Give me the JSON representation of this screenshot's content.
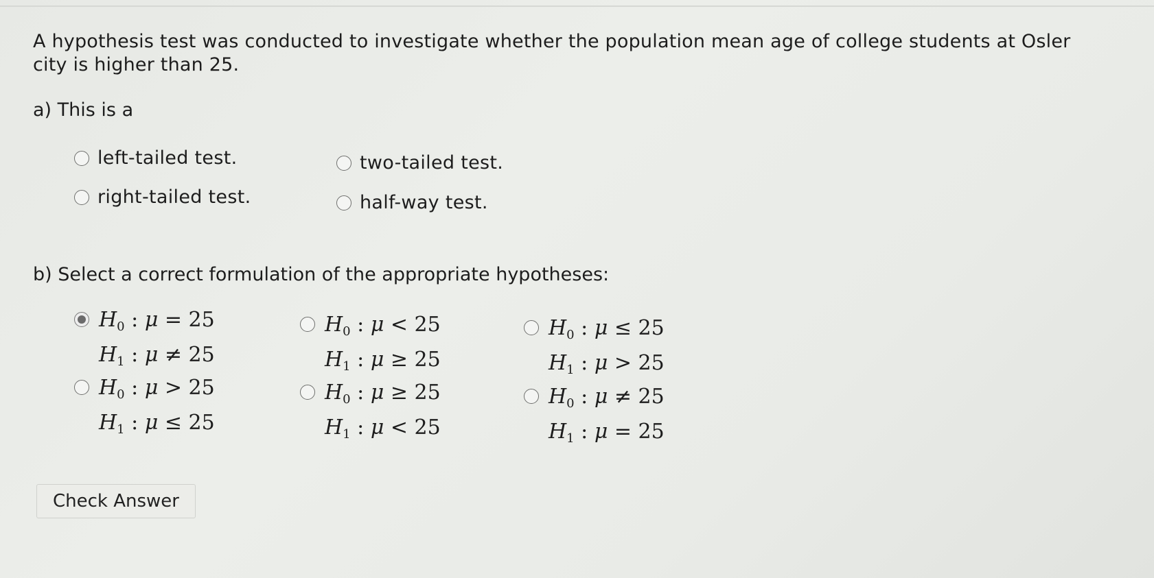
{
  "question": {
    "text": "A hypothesis test was conducted to investigate whether the population mean age of college students at Osler city is higher than 25."
  },
  "part_a": {
    "label": "a) This is a",
    "options": [
      {
        "label": "left-tailed test.",
        "selected": false
      },
      {
        "label": "two-tailed test.",
        "selected": false
      },
      {
        "label": "right-tailed test.",
        "selected": false
      },
      {
        "label": "half-way test.",
        "selected": false
      }
    ]
  },
  "part_b": {
    "label": "b) Select a correct formulation of the appropriate hypotheses:",
    "options": [
      {
        "h0_rel": "=",
        "h0_val": "25",
        "h1_rel": "≠",
        "h1_val": "25",
        "selected": true
      },
      {
        "h0_rel": "<",
        "h0_val": "25",
        "h1_rel": "≥",
        "h1_val": "25",
        "selected": false
      },
      {
        "h0_rel": "≤",
        "h0_val": "25",
        "h1_rel": ">",
        "h1_val": "25",
        "selected": false
      },
      {
        "h0_rel": ">",
        "h0_val": "25",
        "h1_rel": "≤",
        "h1_val": "25",
        "selected": false
      },
      {
        "h0_rel": "≥",
        "h0_val": "25",
        "h1_rel": "<",
        "h1_val": "25",
        "selected": false
      },
      {
        "h0_rel": "≠",
        "h0_val": "25",
        "h1_rel": "=",
        "h1_val": "25",
        "selected": false
      }
    ]
  },
  "check_answer_label": "Check Answer"
}
